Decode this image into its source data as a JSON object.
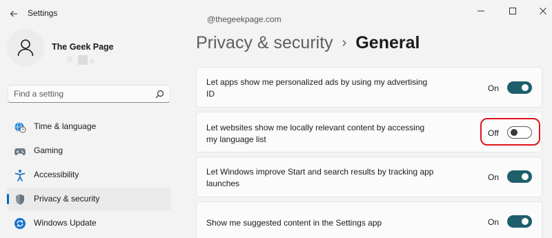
{
  "window": {
    "title": "Settings",
    "controls": {
      "minimize": "minimize-icon",
      "maximize": "maximize-icon",
      "close": "close-icon"
    }
  },
  "watermark": "@thegeekpage.com",
  "profile": {
    "name": "The Geek Page"
  },
  "search": {
    "placeholder": "Find a setting"
  },
  "sidebar": {
    "items": [
      {
        "label": "Time & language",
        "icon": "globe-clock-icon",
        "selected": false
      },
      {
        "label": "Gaming",
        "icon": "gamepad-icon",
        "selected": false
      },
      {
        "label": "Accessibility",
        "icon": "accessibility-icon",
        "selected": false
      },
      {
        "label": "Privacy & security",
        "icon": "shield-icon",
        "selected": true
      },
      {
        "label": "Windows Update",
        "icon": "update-icon",
        "selected": false
      }
    ]
  },
  "breadcrumb": {
    "parent": "Privacy & security",
    "separator": "›",
    "current": "General"
  },
  "settings": [
    {
      "text": "Let apps show me personalized ads by using my advertising ID",
      "state_label": "On",
      "enabled": true
    },
    {
      "text": "Let websites show me locally relevant content by accessing my language list",
      "state_label": "Off",
      "enabled": false
    },
    {
      "text": "Let Windows improve Start and search results by tracking app launches",
      "state_label": "On",
      "enabled": true
    },
    {
      "text": "Show me suggested content in the Settings app",
      "state_label": "On",
      "enabled": true
    }
  ],
  "colors": {
    "accent": "#0067c0",
    "toggle_on": "#1e5f6b",
    "highlight": "#e0141e"
  }
}
